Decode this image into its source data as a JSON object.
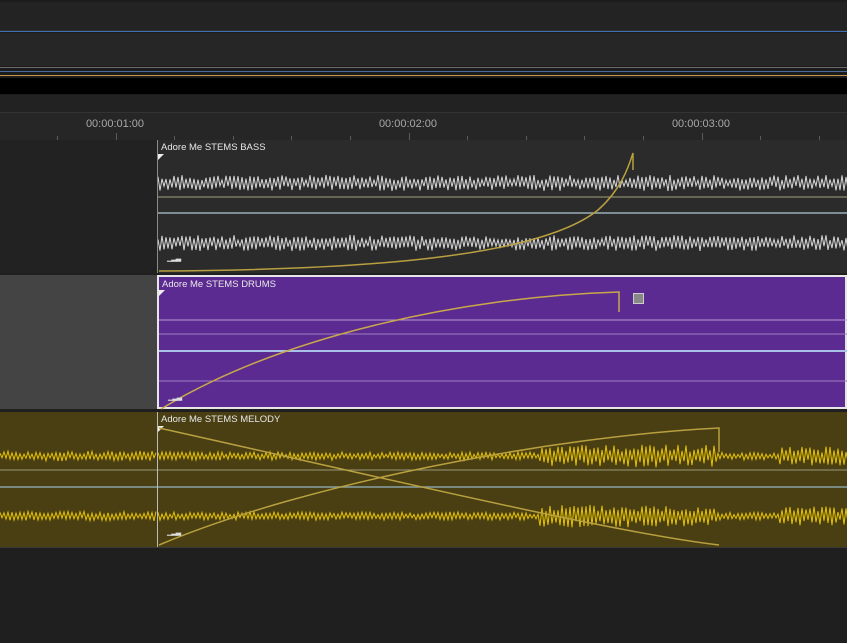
{
  "ruler": {
    "labels": [
      "00:00:01:00",
      "00:00:02:00",
      "00:00:03:00"
    ]
  },
  "tracks": [
    {
      "clip_name": "Adore Me STEMS BASS",
      "clip_color": "#2b2b2b",
      "wave_color": "#d8d8d8"
    },
    {
      "clip_name": "Adore Me STEMS DRUMS",
      "clip_color": "#5c2b92",
      "wave_color": "#c8a0f0"
    },
    {
      "clip_name": "Adore Me STEMS MELODY",
      "clip_color": "#4a3f12",
      "wave_color": "#e6c300"
    }
  ],
  "colors": {
    "envelope": "#b8a040",
    "playhead_blue": "#3f6fb2",
    "accent_orange": "#c8964b"
  },
  "icons": {
    "fade_handle": "fade-triangle-icon",
    "level_meter": "level-bars-icon",
    "clip_fx": "clip-fx-square-icon"
  }
}
